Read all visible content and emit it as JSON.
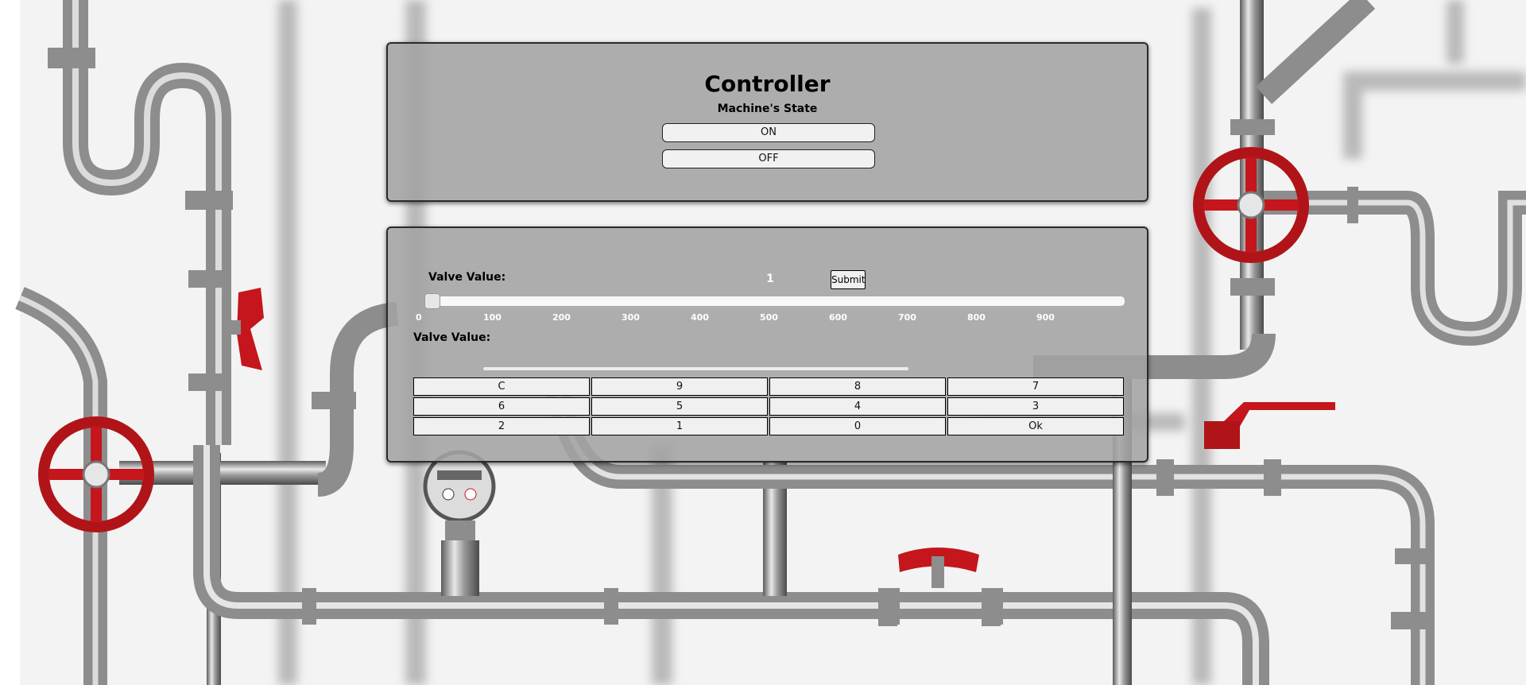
{
  "controller": {
    "title": "Controller",
    "subtitle": "Machine's State",
    "on_label": "ON",
    "off_label": "OFF"
  },
  "valve": {
    "label": "Valve Value:",
    "value": "1",
    "submit_label": "Submit",
    "slider_value": 0,
    "slider_range": [
      0,
      1000
    ],
    "ticks": [
      "0",
      "100",
      "200",
      "300",
      "400",
      "500",
      "600",
      "700",
      "800",
      "900"
    ],
    "second_label": "Valve Value:"
  },
  "keypad": {
    "keys": [
      "C",
      "9",
      "8",
      "7",
      "6",
      "5",
      "4",
      "3",
      "2",
      "1",
      "0",
      "Ok"
    ]
  },
  "background": {
    "scene": "industrial-pipes-with-red-valves",
    "pipe_color": "#9a9a9a",
    "valve_color": "#c4161c"
  }
}
